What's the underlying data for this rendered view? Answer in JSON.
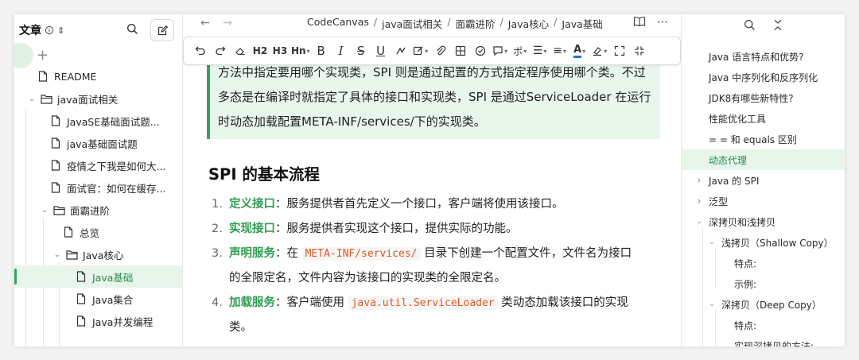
{
  "sidebar": {
    "title": "文章",
    "items": [
      {
        "label": "README",
        "type": "doc",
        "level": 0
      },
      {
        "label": "java面试相关",
        "type": "folder",
        "level": 0,
        "expanded": true
      },
      {
        "label": "JavaSE基础面试题...",
        "type": "doc",
        "level": 1
      },
      {
        "label": "java基础面试题",
        "type": "doc",
        "level": 1
      },
      {
        "label": "疫情之下我是如何大...",
        "type": "doc",
        "level": 1
      },
      {
        "label": "面试官：如何在缓存...",
        "type": "doc",
        "level": 1
      },
      {
        "label": "面霸进阶",
        "type": "folder",
        "level": 1,
        "expanded": true
      },
      {
        "label": "总览",
        "type": "doc",
        "level": 2
      },
      {
        "label": "Java核心",
        "type": "folder",
        "level": 2,
        "expanded": true
      },
      {
        "label": "Java基础",
        "type": "doc",
        "level": 3,
        "active": true
      },
      {
        "label": "Java集合",
        "type": "doc",
        "level": 3
      },
      {
        "label": "Java并发编程",
        "type": "doc",
        "level": 3
      }
    ]
  },
  "breadcrumb": [
    "CodeCanvas",
    "java面试相关",
    "面霸进阶",
    "Java核心",
    "Java基础"
  ],
  "toolbar": {
    "h2": "H2",
    "h3": "H3",
    "hn": "Hn",
    "bold": "B",
    "italic": "I",
    "strike": "S",
    "underline": "U",
    "font_color": "A"
  },
  "content": {
    "callout_lines": [
      "方法中指定要用哪个实现类，SPI 则是通过配置的方式指定程序使用哪个类。不过",
      "多态是在编译时就指定了具体的接口和实现类，SPI 是通过ServiceLoader 在运行",
      "时动态加载配置META-INF/services/下的实现类。"
    ],
    "heading": "SPI 的基本流程",
    "steps": [
      {
        "num": "1.",
        "keyword": "定义接口",
        "text": "：服务提供者首先定义一个接口，客户端将使用该接口。",
        "code": "",
        "after": "",
        "line2": ""
      },
      {
        "num": "2.",
        "keyword": "实现接口",
        "text": "：服务提供者实现这个接口，提供实际的功能。",
        "code": "",
        "after": "",
        "line2": ""
      },
      {
        "num": "3.",
        "keyword": "声明服务",
        "text": "：在 ",
        "code": "META-INF/services/",
        "after": " 目录下创建一个配置文件，文件名为接口",
        "line2": "的全限定名，文件内容为该接口的实现类的全限定名。"
      },
      {
        "num": "4.",
        "keyword": "加载服务",
        "text": "：客户端使用 ",
        "code": "java.util.ServiceLoader",
        "after": " 类动态加载该接口的实现",
        "line2": "类。"
      }
    ]
  },
  "outline": {
    "items": [
      {
        "label": "Java 语言特点和优势?",
        "level": 0,
        "chev": ""
      },
      {
        "label": "Java 中序列化和反序列化",
        "level": 0,
        "chev": ""
      },
      {
        "label": "JDK8有哪些新特性?",
        "level": 0,
        "chev": ""
      },
      {
        "label": "性能优化工具",
        "level": 0,
        "chev": ""
      },
      {
        "label": "= = 和 equals 区别",
        "level": 0,
        "chev": ""
      },
      {
        "label": "动态代理",
        "level": 0,
        "chev": "",
        "active": true
      },
      {
        "label": "Java 的 SPI",
        "level": 0,
        "chev": "right"
      },
      {
        "label": "泛型",
        "level": 0,
        "chev": "right"
      },
      {
        "label": "深拷贝和浅拷贝",
        "level": 0,
        "chev": "down"
      },
      {
        "label": "浅拷贝（Shallow Copy）",
        "level": 1,
        "chev": "down"
      },
      {
        "label": "特点:",
        "level": 2,
        "chev": ""
      },
      {
        "label": "示例:",
        "level": 2,
        "chev": ""
      },
      {
        "label": "深拷贝（Deep Copy）",
        "level": 1,
        "chev": "down"
      },
      {
        "label": "特点:",
        "level": 2,
        "chev": ""
      },
      {
        "label": "实现深拷贝的方法:",
        "level": 2,
        "chev": ""
      }
    ]
  },
  "colors": {
    "accent": "#2f9e52",
    "code": "#e4571e",
    "callout_bg": "#e8f6ec"
  }
}
